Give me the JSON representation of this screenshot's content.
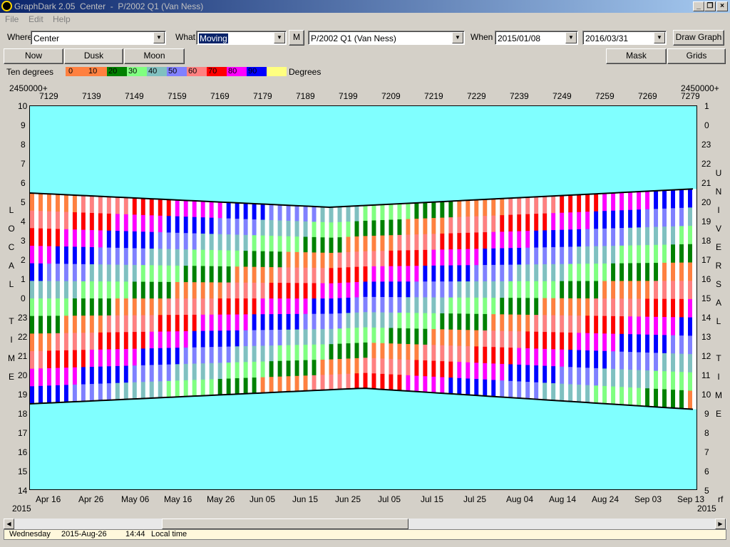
{
  "window": {
    "title": "GraphDark 2.05  Center  -  P/2002 Q1 (Van Ness)",
    "min": "_",
    "restore": "❐",
    "close": "×"
  },
  "menu": {
    "file": "File",
    "edit": "Edit",
    "help": "Help"
  },
  "toolbar": {
    "where_label": "Where",
    "where_value": "Center",
    "what_label": "What",
    "what_value": "Moving",
    "m_button": "M",
    "object_value": "P/2002 Q1 (Van Ness)",
    "when_label": "When",
    "when_start": "2015/01/08",
    "when_end": "2016/03/31",
    "draw_graph": "Draw Graph"
  },
  "buttons": {
    "now": "Now",
    "dusk": "Dusk",
    "moon": "Moon",
    "mask": "Mask",
    "grids": "Grids"
  },
  "legend": {
    "label": "Ten degrees",
    "unit": "Degrees",
    "items": [
      {
        "text": "0",
        "color": "#ff8040"
      },
      {
        "text": "10",
        "color": "#ff8040"
      },
      {
        "text": "20",
        "color": "#008000"
      },
      {
        "text": "30",
        "color": "#80ff80"
      },
      {
        "text": "40",
        "color": "#80c0c0"
      },
      {
        "text": "50",
        "color": "#8080ff"
      },
      {
        "text": "60",
        "color": "#ff8080"
      },
      {
        "text": "70",
        "color": "#ff0000"
      },
      {
        "text": "80",
        "color": "#ff00ff"
      },
      {
        "text": "90",
        "color": "#0000ff"
      },
      {
        "text": "",
        "color": "#ffff80"
      }
    ]
  },
  "axes": {
    "jd_prefix": "2450000+",
    "jd_ticks": [
      "7129",
      "7139",
      "7149",
      "7159",
      "7169",
      "7179",
      "7189",
      "7199",
      "7209",
      "7219",
      "7229",
      "7239",
      "7249",
      "7259",
      "7269",
      "7279"
    ],
    "date_ticks": [
      "Apr 16",
      "Apr 26",
      "May 06",
      "May 16",
      "May 26",
      "Jun 05",
      "Jun 15",
      "Jun 25",
      "Jul 05",
      "Jul 15",
      "Jul 25",
      "Aug 04",
      "Aug 14",
      "Aug 24",
      "Sep 03",
      "Sep 13"
    ],
    "year_left": "2015",
    "year_right": "2015",
    "rf": "rf",
    "local_hours": [
      "10",
      "9",
      "8",
      "7",
      "6",
      "5",
      "4",
      "3",
      "2",
      "1",
      "0",
      "23",
      "22",
      "21",
      "20",
      "19",
      "18",
      "17",
      "16",
      "15",
      "14"
    ],
    "ut_hours": [
      "1",
      "0",
      "23",
      "22",
      "21",
      "20",
      "19",
      "18",
      "17",
      "16",
      "15",
      "14",
      "13",
      "12",
      "11",
      "10",
      "9",
      "8",
      "7",
      "6",
      "5"
    ],
    "left_vertical": [
      "L",
      "O",
      "C",
      "A",
      "L",
      "",
      "T",
      "I",
      "M",
      "E"
    ],
    "right_vertical_top": [
      "U",
      "N",
      "I",
      "V",
      "E",
      "R",
      "S",
      "A",
      "L"
    ],
    "right_vertical_bottom": [
      "T",
      "I",
      "M",
      "E"
    ]
  },
  "status": {
    "day": "Wednesday",
    "date": "2015-Aug-26",
    "time": "14:44",
    "mode": "Local time"
  },
  "colors": {
    "sky": "#80ffff",
    "night": "#000040",
    "twilight": "#0080c0",
    "grey": "#c0c0c0"
  }
}
